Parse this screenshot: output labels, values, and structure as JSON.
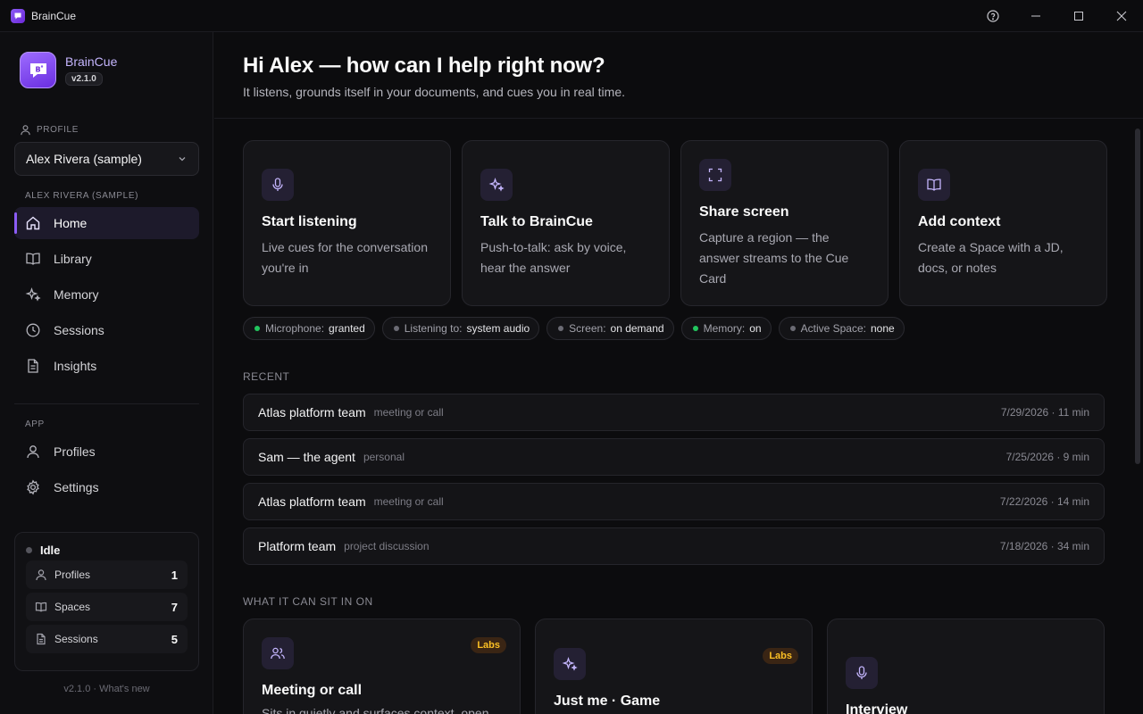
{
  "window": {
    "title": "BrainCue"
  },
  "brand": {
    "name": "BrainCue",
    "version": "v2.1.0"
  },
  "sidebar": {
    "profile_label": "PROFILE",
    "profile_selected": "Alex Rivera (sample)",
    "profile_section": "ALEX RIVERA (SAMPLE)",
    "nav": [
      {
        "label": "Home",
        "icon": "home-icon",
        "active": true
      },
      {
        "label": "Library",
        "icon": "book-icon"
      },
      {
        "label": "Memory",
        "icon": "sparkles-icon"
      },
      {
        "label": "Sessions",
        "icon": "clock-icon"
      },
      {
        "label": "Insights",
        "icon": "document-icon"
      }
    ],
    "app_label": "APP",
    "app_nav": [
      {
        "label": "Profiles",
        "icon": "user-icon"
      },
      {
        "label": "Settings",
        "icon": "gear-icon"
      }
    ],
    "status": {
      "state": "Idle",
      "rows": [
        {
          "label": "Profiles",
          "count": "1",
          "icon": "user-icon"
        },
        {
          "label": "Spaces",
          "count": "7",
          "icon": "book-icon"
        },
        {
          "label": "Sessions",
          "count": "5",
          "icon": "document-icon"
        }
      ]
    },
    "footer": "v2.1.0 · What's new"
  },
  "main": {
    "greeting": "Hi Alex — how can I help right now?",
    "subtitle": "It listens, grounds itself in your documents, and cues you in real time.",
    "actions": [
      {
        "title": "Start listening",
        "desc": "Live cues for the conversation you're in",
        "icon": "microphone-icon"
      },
      {
        "title": "Talk to BrainCue",
        "desc": "Push-to-talk: ask by voice, hear the answer",
        "icon": "sparkles-icon"
      },
      {
        "title": "Share screen",
        "desc": "Capture a region — the answer streams to the Cue Card",
        "icon": "screen-capture-icon"
      },
      {
        "title": "Add context",
        "desc": "Create a Space with a JD, docs, or notes",
        "icon": "book-open-icon"
      }
    ],
    "chips": [
      {
        "label": "Microphone:",
        "value": "granted",
        "dot": "#22c55e"
      },
      {
        "label": "Listening to:",
        "value": "system audio",
        "dot": "#6b6b74"
      },
      {
        "label": "Screen:",
        "value": "on demand",
        "dot": "#6b6b74"
      },
      {
        "label": "Memory:",
        "value": "on",
        "dot": "#22c55e"
      },
      {
        "label": "Active Space:",
        "value": "none",
        "dot": "#6b6b74"
      }
    ],
    "recent_label": "RECENT",
    "recent": [
      {
        "title": "Atlas platform team",
        "kind": "meeting or call",
        "meta": "7/29/2026 · 11 min"
      },
      {
        "title": "Sam — the agent",
        "kind": "personal",
        "meta": "7/25/2026 · 9 min"
      },
      {
        "title": "Atlas platform team",
        "kind": "meeting or call",
        "meta": "7/22/2026 · 14 min"
      },
      {
        "title": "Platform team",
        "kind": "project discussion",
        "meta": "7/18/2026 · 34 min"
      }
    ],
    "modes_label": "WHAT IT CAN SIT IN ON",
    "modes": [
      {
        "title": "Meeting or call",
        "desc": "Sits in quietly and surfaces context, open",
        "badge": "Labs",
        "icon": "users-icon"
      },
      {
        "title": "Just me · Game",
        "desc": "",
        "badge": "Labs",
        "icon": "sparkles-icon"
      },
      {
        "title": "Interview",
        "desc": "",
        "badge": "",
        "icon": "microphone-icon"
      }
    ]
  },
  "colors": {
    "accent": "#8b5cf6",
    "granted": "#22c55e",
    "labs": "#fbbf24"
  }
}
